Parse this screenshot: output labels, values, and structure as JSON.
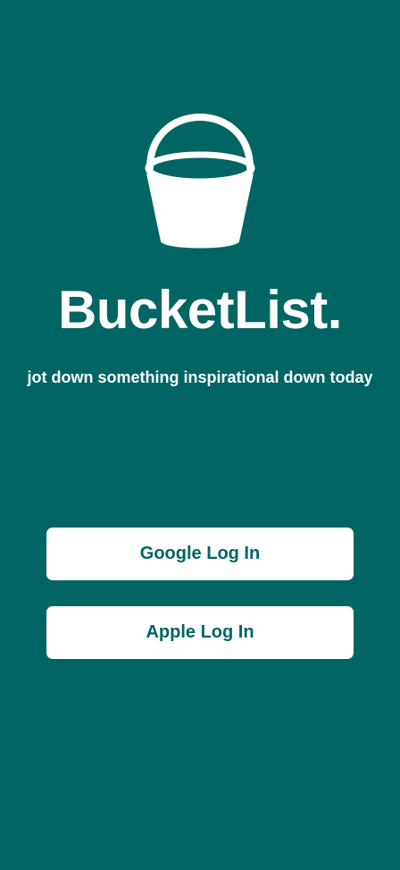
{
  "app": {
    "title": "BucketList.",
    "tagline": "jot down something inspirational down today"
  },
  "logo": {
    "icon": "bucket-icon",
    "color": "#ffffff"
  },
  "auth": {
    "google_label": "Google Log In",
    "apple_label": "Apple Log In"
  },
  "theme": {
    "background": "#006563",
    "button_background": "#ffffff",
    "button_text": "#006563"
  }
}
